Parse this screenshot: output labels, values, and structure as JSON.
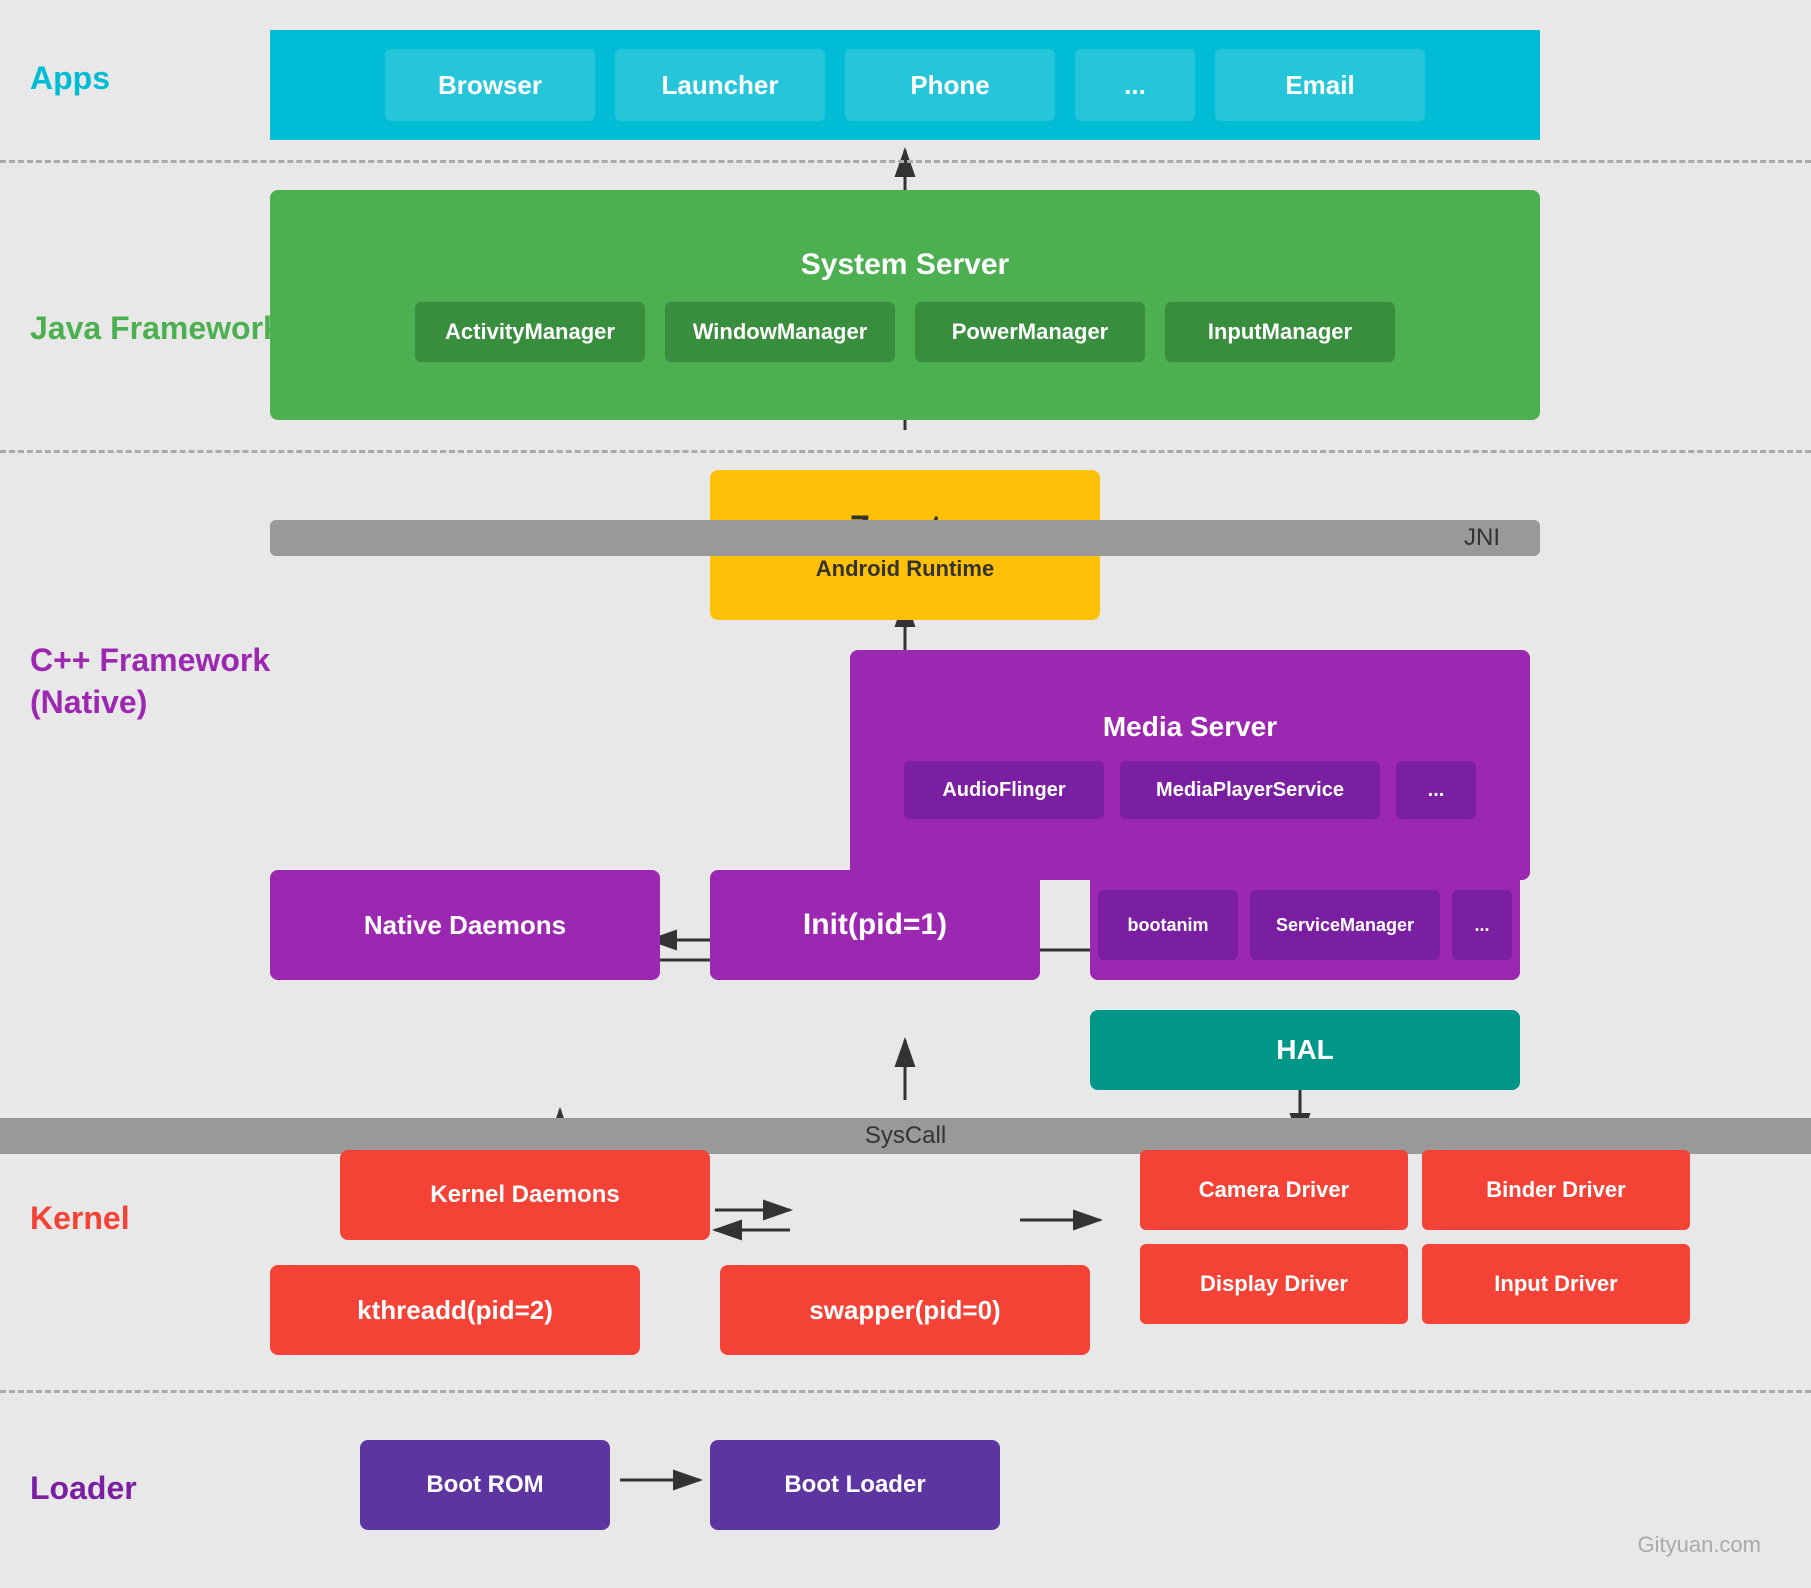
{
  "layers": {
    "apps": {
      "label": "Apps",
      "color": "#00BCD4",
      "items": [
        "Browser",
        "Launcher",
        "Phone",
        "...",
        "Email"
      ]
    },
    "java_framework": {
      "label": "Java Framework",
      "color": "#4CAF50",
      "system_server": {
        "title": "System Server",
        "items": [
          "ActivityManager",
          "WindowManager",
          "PowerManager",
          "InputManager"
        ]
      }
    },
    "cpp_framework": {
      "label": "C++ Framework\n(Native)",
      "color": "#9C27B0",
      "media_server": {
        "title": "Media Server",
        "items": [
          "AudioFlinger",
          "MediaPlayerService",
          "..."
        ]
      },
      "init": "Init(pid=1)",
      "native_daemons": "Native Daemons",
      "right_items": [
        "bootanim",
        "ServiceManager",
        "..."
      ],
      "hal": "HAL",
      "jni": "JNI"
    },
    "kernel": {
      "label": "Kernel",
      "color": "#F44336",
      "kernel_daemons": "Kernel Daemons",
      "kthreadd": "kthreadd(pid=2)",
      "swapper": "swapper(pid=0)",
      "drivers": {
        "camera": "Camera Driver",
        "binder": "Binder Driver",
        "display": "Display Driver",
        "input": "Input Driver"
      },
      "syscall": "SysCall"
    },
    "loader": {
      "label": "Loader",
      "color": "#7B1FA2",
      "boot_rom": "Boot ROM",
      "boot_loader": "Boot Loader"
    }
  },
  "zygote": {
    "title": "Zygote",
    "subtitle": "Android Runtime"
  },
  "watermark": "Gityuan.com"
}
